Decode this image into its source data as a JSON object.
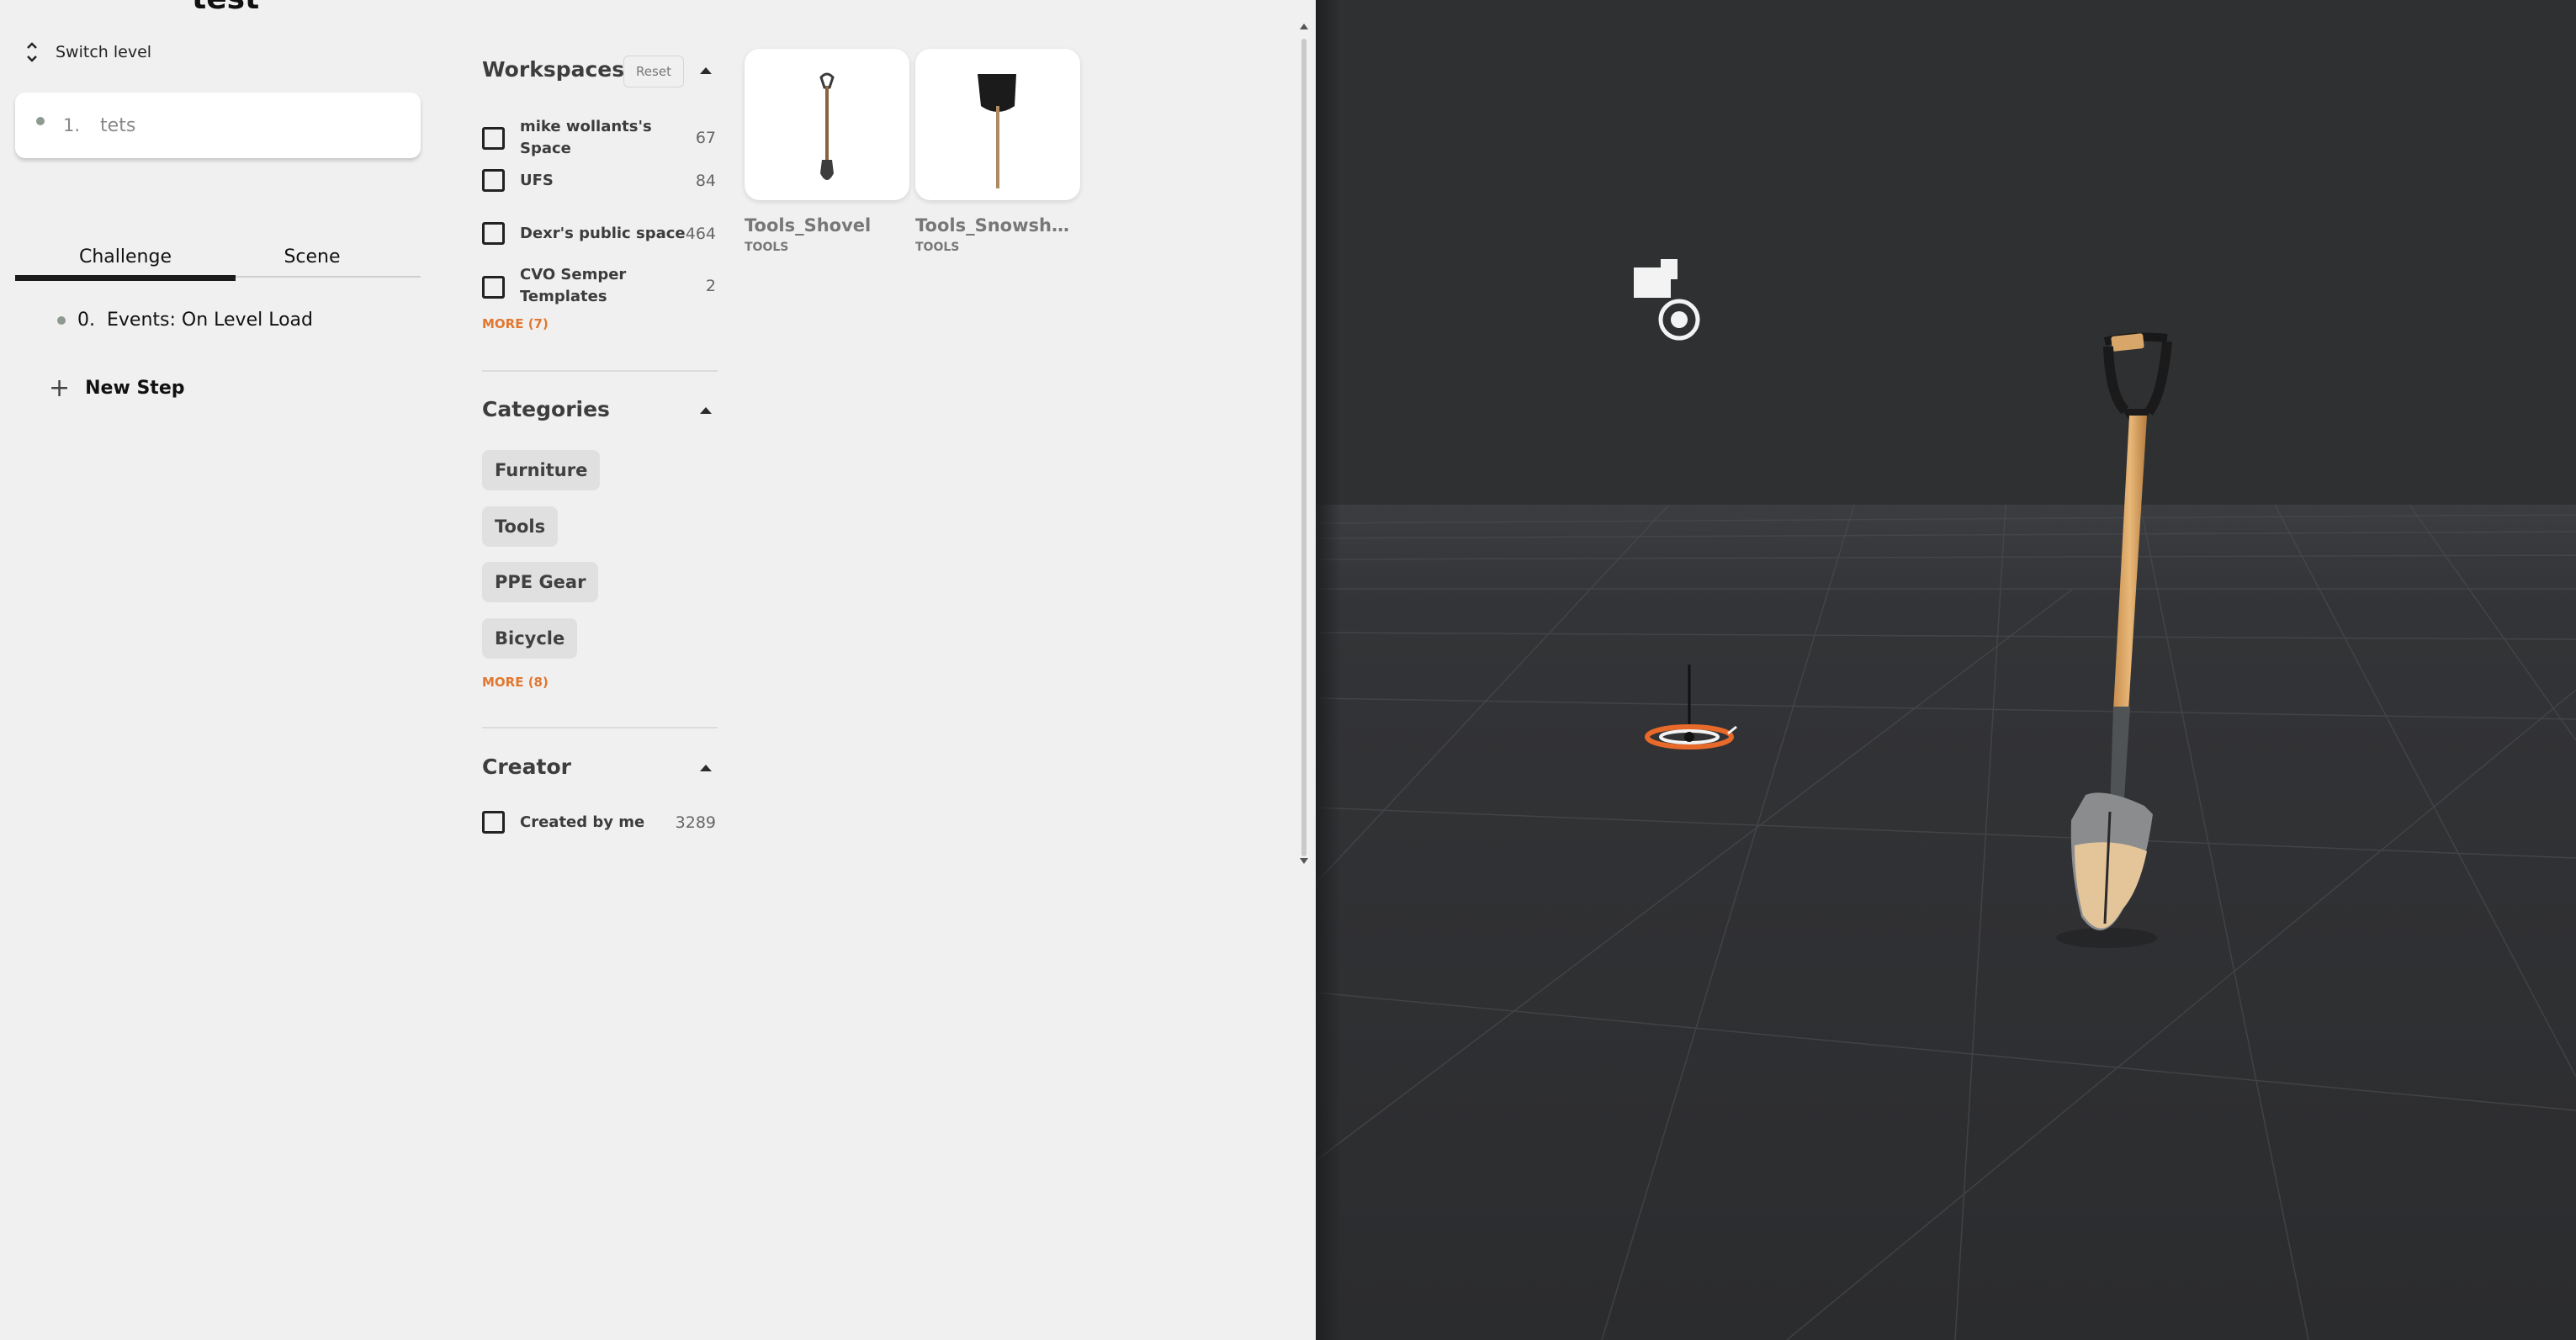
{
  "level": {
    "title": "test",
    "switch_label": "Switch level",
    "current": {
      "number": "1.",
      "name": "tets"
    }
  },
  "tabs": [
    {
      "label": "Challenge",
      "active": true
    },
    {
      "label": "Scene",
      "active": false
    }
  ],
  "steps": [
    {
      "number": "0.",
      "label": "Events: On Level Load"
    }
  ],
  "new_step_label": "New Step",
  "filters": {
    "workspaces": {
      "title": "Workspaces",
      "reset_label": "Reset",
      "items": [
        {
          "name": "mike wollants's Space",
          "count": "67"
        },
        {
          "name": "UFS",
          "count": "84"
        },
        {
          "name": "Dexr's public space",
          "count": "464"
        },
        {
          "name": "CVO Semper Templates",
          "count": "2"
        }
      ],
      "more_label": "MORE (7)"
    },
    "categories": {
      "title": "Categories",
      "items": [
        "Furniture",
        "Tools",
        "PPE Gear",
        "Bicycle"
      ],
      "more_label": "MORE (8)"
    },
    "creator": {
      "title": "Creator",
      "items": [
        {
          "name": "Created by me",
          "count": "3289"
        }
      ]
    }
  },
  "results": [
    {
      "name": "Tools_Shovel",
      "category": "TOOLS",
      "icon": "shovel-icon"
    },
    {
      "name": "Tools_Snowsho...",
      "category": "TOOLS",
      "icon": "snow-shovel-icon"
    }
  ],
  "colors": {
    "accent_orange": "#e2772f",
    "viewport_bg": "#2f3032",
    "panel_bg": "#f0f0f0"
  }
}
